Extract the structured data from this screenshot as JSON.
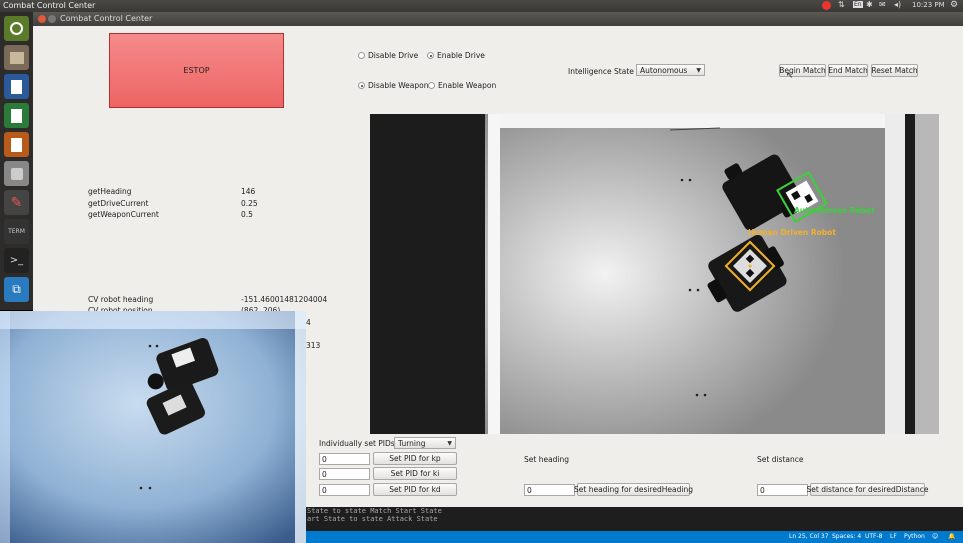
{
  "topbar": {
    "title": "Combat Control Center",
    "time": "10:23 PM",
    "lang": "En"
  },
  "window": {
    "title": "Combat Control Center"
  },
  "estop": {
    "label": "ESTOP"
  },
  "drive": {
    "disable": "Disable Drive",
    "enable": "Enable Drive",
    "selected": "enable"
  },
  "weapon": {
    "disable": "Disable Weapon",
    "enable": "Enable Weapon",
    "selected": "disable"
  },
  "intelligence": {
    "label": "Intelligence State",
    "value": "Autonomous"
  },
  "match": {
    "begin": "Begin Match",
    "end": "End Match",
    "reset": "Reset Match"
  },
  "telemetry": [
    {
      "name": "getHeading",
      "value": "146"
    },
    {
      "name": "getDriveCurrent",
      "value": "0.25"
    },
    {
      "name": "getWeaponCurrent",
      "value": "0.5"
    }
  ],
  "cv": [
    {
      "name": "CV robot heading",
      "value": "-151.46001481204004"
    },
    {
      "name": "CV robot position",
      "value": "(862, 206)"
    }
  ],
  "cv_partial": [
    "4",
    "313"
  ],
  "feed": {
    "auto_label": "Autonomous Robot",
    "human_label": "Human Driven Robot"
  },
  "pid": {
    "label": "Individually set PIDs:",
    "mode": "Turning",
    "rows": [
      {
        "value": "0",
        "button": "Set PID for kp"
      },
      {
        "value": "0",
        "button": "Set PID for ki"
      },
      {
        "value": "0",
        "button": "Set PID for kd"
      }
    ]
  },
  "heading": {
    "label": "Set heading",
    "value": "0",
    "button": "Set heading for desiredHeading"
  },
  "distance": {
    "label": "Set distance",
    "value": "0",
    "button": "Set distance for desiredDistance"
  },
  "terminal": {
    "lines": [
      "State to state Match Start State",
      "art State to state Attack State"
    ]
  },
  "statusbar": {
    "position": "Ln 25, Col 37",
    "spaces": "Spaces: 4",
    "encoding": "UTF-8",
    "eol": "LF",
    "language": "Python"
  }
}
